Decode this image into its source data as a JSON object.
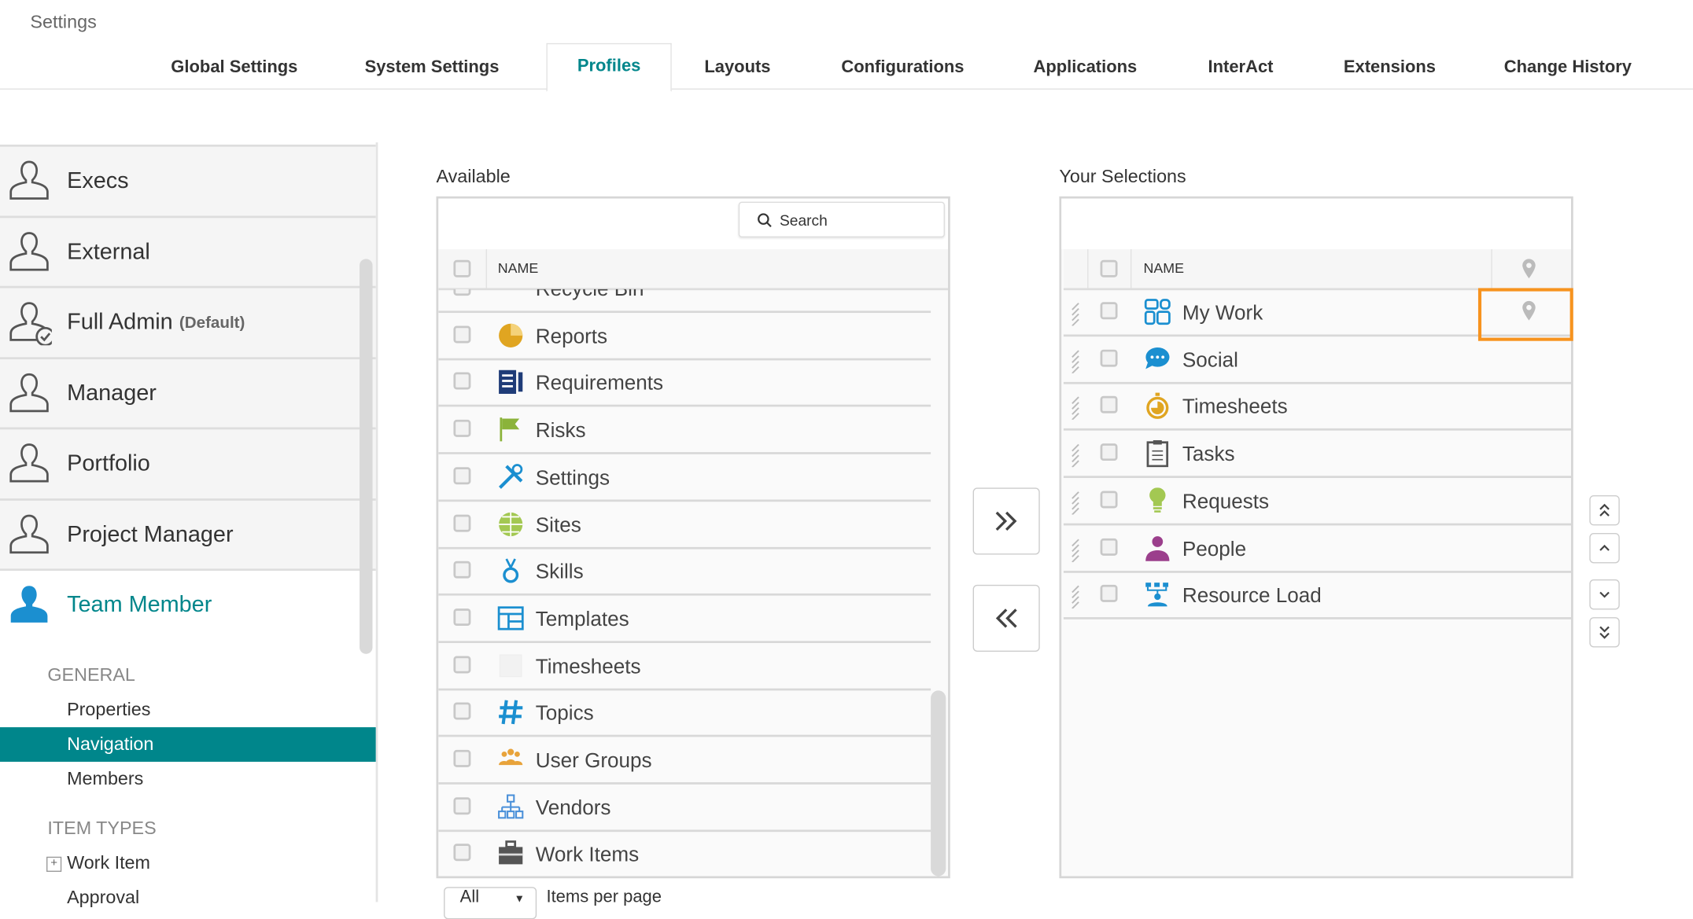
{
  "header": {
    "title": "Settings"
  },
  "tabs": [
    {
      "label": "Global Settings"
    },
    {
      "label": "System Settings"
    },
    {
      "label": "Profiles",
      "active": true
    },
    {
      "label": "Layouts"
    },
    {
      "label": "Configurations"
    },
    {
      "label": "Applications"
    },
    {
      "label": "InterAct"
    },
    {
      "label": "Extensions"
    },
    {
      "label": "Change History"
    }
  ],
  "profiles": [
    {
      "label": "Execs"
    },
    {
      "label": "External"
    },
    {
      "label": "Full Admin",
      "tag": "(Default)"
    },
    {
      "label": "Manager"
    },
    {
      "label": "Portfolio"
    },
    {
      "label": "Project Manager"
    },
    {
      "label": "Team Member",
      "selected": true
    }
  ],
  "sections": {
    "general": "GENERAL",
    "general_items": [
      "Properties",
      "Navigation",
      "Members"
    ],
    "selected": "Navigation",
    "item_types": "ITEM TYPES",
    "item_type_items": [
      "Work Item",
      "Approval"
    ]
  },
  "available": {
    "label": "Available",
    "search_placeholder": "Search",
    "column": "NAME",
    "items": [
      "Recycle Bin",
      "Reports",
      "Requirements",
      "Risks",
      "Settings",
      "Sites",
      "Skills",
      "Templates",
      "Timesheets",
      "Topics",
      "User Groups",
      "Vendors",
      "Work Items"
    ],
    "per_page_value": "All",
    "per_page_label": "Items per page"
  },
  "selections": {
    "label": "Your Selections",
    "column": "NAME",
    "items": [
      "My Work",
      "Social",
      "Timesheets",
      "Tasks",
      "Requests",
      "People",
      "Resource Load"
    ],
    "pinned_highlight": "My Work"
  },
  "colors": {
    "accent": "#00868b",
    "highlight": "#f7931e"
  }
}
